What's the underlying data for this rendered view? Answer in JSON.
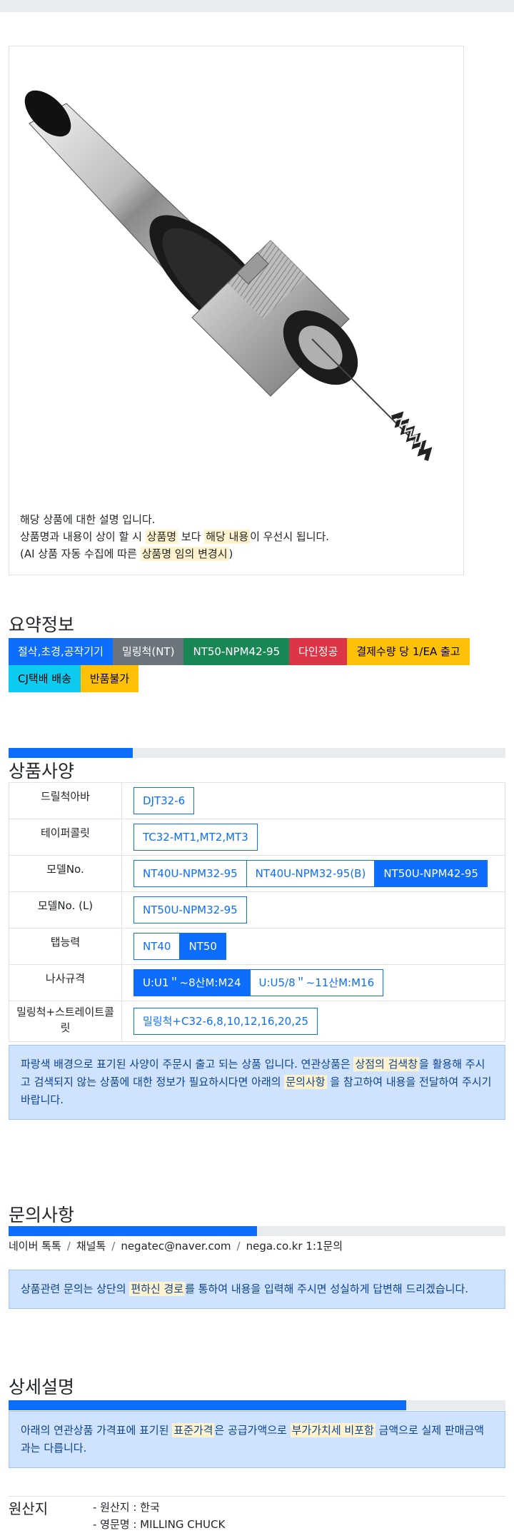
{
  "product": {
    "image_alt": "NT 밀링척 공구 홀더",
    "desc": {
      "line1": "해당 상품에 대한 설명 입니다.",
      "line2_a": "상품명과 내용이 상이 할 시 ",
      "line2_hl1": "상품명",
      "line2_b": " 보다 ",
      "line2_hl2": "해당 내용",
      "line2_c": "이 우선시 됩니다.",
      "line3_a": "(AI 상품 자동 수집에 따른 ",
      "line3_hl": "상품명 임의 변경시",
      "line3_b": ")"
    }
  },
  "summary": {
    "title": "요약정보",
    "badges": [
      {
        "label": "절삭,초경,공작기기",
        "bg": "#0d6efd",
        "fg": "#ffffff"
      },
      {
        "label": "밀링척(NT)",
        "bg": "#6c757d",
        "fg": "#ffffff"
      },
      {
        "label": "NT50-NPM42-95",
        "bg": "#198754",
        "fg": "#ffffff"
      },
      {
        "label": "다인정공",
        "bg": "#dc3545",
        "fg": "#ffffff"
      },
      {
        "label": "결제수량 당 1/EA 출고",
        "bg": "#ffc107",
        "fg": "#000000"
      },
      {
        "label": "CJ택배 배송",
        "bg": "#0dcaf0",
        "fg": "#000000"
      },
      {
        "label": "반품불가",
        "bg": "#ffc107",
        "fg": "#000000"
      }
    ]
  },
  "spec": {
    "title": "상품사양",
    "progress": 0.25,
    "rows": [
      {
        "label": "드릴척아바",
        "options": [
          {
            "label": "DJT32-6",
            "selected": false
          }
        ]
      },
      {
        "label": "테이퍼콜릿",
        "options": [
          {
            "label": "TC32-MT1,MT2,MT3",
            "selected": false
          }
        ]
      },
      {
        "label": "모델No.",
        "options": [
          {
            "label": "NT40U-NPM32-95",
            "selected": false
          },
          {
            "label": "NT40U-NPM32-95(B)",
            "selected": false
          },
          {
            "label": "NT50U-NPM42-95",
            "selected": true
          }
        ]
      },
      {
        "label": "모델No. (L)",
        "options": [
          {
            "label": "NT50U-NPM32-95",
            "selected": false
          }
        ]
      },
      {
        "label": "탭능력",
        "options": [
          {
            "label": "NT40",
            "selected": false
          },
          {
            "label": "NT50",
            "selected": true
          }
        ]
      },
      {
        "label": "나사규격",
        "options": [
          {
            "label": "U:U1＂~8산M:M24",
            "selected": true
          },
          {
            "label": "U:U5/8＂~11산M:M16",
            "selected": false
          }
        ]
      },
      {
        "label": "밀링척+스트레이트콜릿",
        "options": [
          {
            "label": "밀링척+C32-6,8,10,12,16,20,25",
            "selected": false
          }
        ]
      }
    ],
    "notice": {
      "a": "파랑색 배경으로 표기된 사양이 주문시 출고 되는 상품 입니다. 연관상품은 ",
      "hl1": "상점의 검색창",
      "b": "을 활용해 주시고 검색되지 않는 상품에 대한 정보가 필요하시다면 아래의 ",
      "hl2": "문의사항",
      "c": " 을 참고하여 내용을 전달하여 주시기 바랍니다."
    }
  },
  "inquiry": {
    "title": "문의사항",
    "progress": 0.5,
    "links": [
      "네이버 톡톡",
      "채널톡",
      "negatec@naver.com",
      "nega.co.kr 1:1문의"
    ],
    "notice": {
      "a": "상품관련 문의는 상단의 ",
      "hl": "편하신 경로",
      "b": "를 통하여 내용을 입력해 주시면 성실하게 답변해 드리겠습니다."
    }
  },
  "detail": {
    "title": "상세설명",
    "progress": 0.8,
    "notice": {
      "a": "아래의 연관상품 가격표에 표기된 ",
      "hl1": "표준가격",
      "b": "은 공급가액으로 ",
      "hl2": "부가가치세 비포함",
      "c": " 금액으로 실제 판매금액과는 다릅니다."
    }
  },
  "origin": {
    "title": "원산지",
    "items": [
      "- 원산지 : 한국",
      "- 영문명 : MILLING CHUCK"
    ]
  }
}
